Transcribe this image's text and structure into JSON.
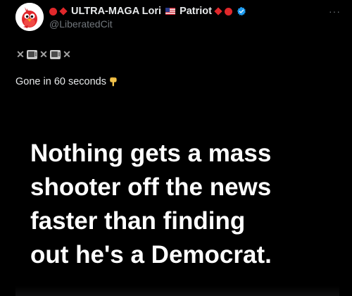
{
  "post": {
    "display_name": "ULTRA-MAGA Lori",
    "display_name_suffix": "Patriot",
    "handle": "@LiberatedCit",
    "more_label": "···",
    "emoji_line": {
      "x1": "✕",
      "x2": "✕",
      "x3": "✕",
      "icons": [
        "x-icon",
        "tv-icon",
        "x-icon",
        "tv-icon",
        "x-icon"
      ]
    },
    "body_text": "Gone in 60 seconds",
    "media": {
      "line1": "Nothing gets a mass",
      "line2": "shooter off the news",
      "line3": "faster than finding",
      "line4": "out he's a Democrat."
    }
  },
  "colors": {
    "background": "#000000",
    "text_primary": "#e7e9ea",
    "text_secondary": "#71767b",
    "accent_red": "#e0282b",
    "verified_blue": "#1d9bf0"
  }
}
